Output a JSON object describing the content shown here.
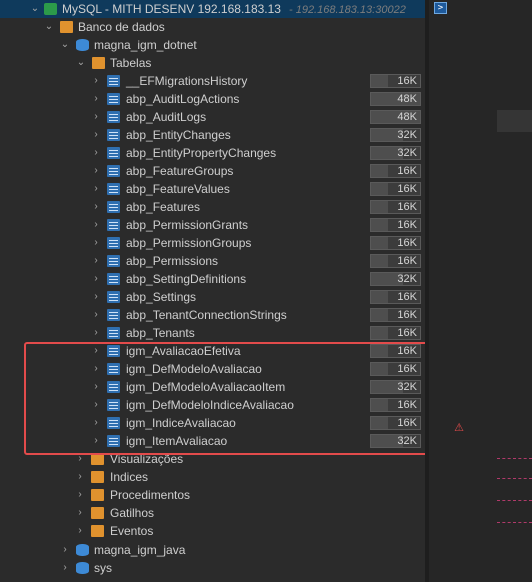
{
  "connection": {
    "label": "MySQL - MITH DESENV 192.168.183.13",
    "host": "- 192.168.183.13:30022"
  },
  "databases_label": "Banco de dados",
  "schema": "magna_igm_dotnet",
  "tables_label": "Tabelas",
  "tables": [
    {
      "name": "__EFMigrationsHistory",
      "size": "16K",
      "fill": 0.35
    },
    {
      "name": "abp_AuditLogActions",
      "size": "48K",
      "fill": 1.0
    },
    {
      "name": "abp_AuditLogs",
      "size": "48K",
      "fill": 1.0
    },
    {
      "name": "abp_EntityChanges",
      "size": "32K",
      "fill": 0.66
    },
    {
      "name": "abp_EntityPropertyChanges",
      "size": "32K",
      "fill": 0.66
    },
    {
      "name": "abp_FeatureGroups",
      "size": "16K",
      "fill": 0.35
    },
    {
      "name": "abp_FeatureValues",
      "size": "16K",
      "fill": 0.35
    },
    {
      "name": "abp_Features",
      "size": "16K",
      "fill": 0.35
    },
    {
      "name": "abp_PermissionGrants",
      "size": "16K",
      "fill": 0.35
    },
    {
      "name": "abp_PermissionGroups",
      "size": "16K",
      "fill": 0.35
    },
    {
      "name": "abp_Permissions",
      "size": "16K",
      "fill": 0.35
    },
    {
      "name": "abp_SettingDefinitions",
      "size": "32K",
      "fill": 0.66
    },
    {
      "name": "abp_Settings",
      "size": "16K",
      "fill": 0.35
    },
    {
      "name": "abp_TenantConnectionStrings",
      "size": "16K",
      "fill": 0.35
    },
    {
      "name": "abp_Tenants",
      "size": "16K",
      "fill": 0.35
    },
    {
      "name": "igm_AvaliacaoEfetiva",
      "size": "16K",
      "fill": 0.35
    },
    {
      "name": "igm_DefModeloAvaliacao",
      "size": "16K",
      "fill": 0.35
    },
    {
      "name": "igm_DefModeloAvaliacaoItem",
      "size": "32K",
      "fill": 0.66
    },
    {
      "name": "igm_DefModeloIndiceAvaliacao",
      "size": "16K",
      "fill": 0.35
    },
    {
      "name": "igm_IndiceAvaliacao",
      "size": "16K",
      "fill": 0.35
    },
    {
      "name": "igm_ItemAvaliacao",
      "size": "32K",
      "fill": 0.66
    }
  ],
  "folders": [
    "Visualizações",
    "Indices",
    "Procedimentos",
    "Gatilhos",
    "Eventos"
  ],
  "other_schemas": [
    "magna_igm_java",
    "sys"
  ],
  "colors": {
    "highlight": "#e34b4b",
    "table_icon": "#2f6fb0",
    "folder_icon": "#e0922e",
    "db_icon": "#3d8ad6"
  }
}
